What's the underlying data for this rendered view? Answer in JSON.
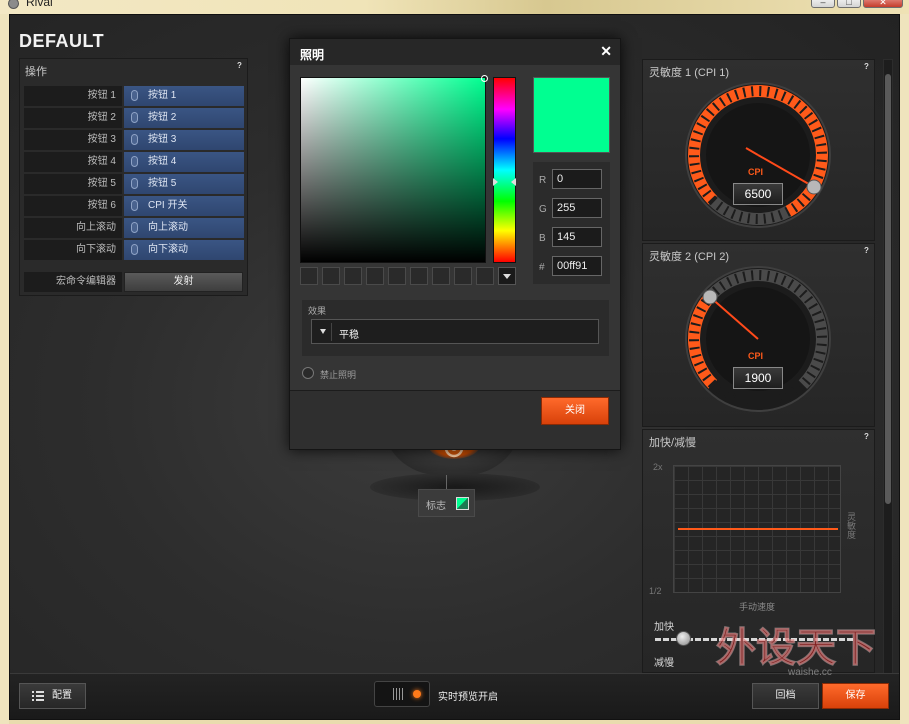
{
  "window": {
    "title": "Rival",
    "controls": [
      "–",
      "□",
      "✕"
    ]
  },
  "profile": {
    "title": "DEFAULT"
  },
  "operations": {
    "label": "操作",
    "help": "?",
    "rows": [
      {
        "name": "按钮 1",
        "action": "按钮 1"
      },
      {
        "name": "按钮 2",
        "action": "按钮 2"
      },
      {
        "name": "按钮 3",
        "action": "按钮 3"
      },
      {
        "name": "按钮 4",
        "action": "按钮 4"
      },
      {
        "name": "按钮 5",
        "action": "按钮 5"
      },
      {
        "name": "按钮 6",
        "action": "CPI 开关"
      },
      {
        "name": "向上滚动",
        "action": "向上滚动"
      },
      {
        "name": "向下滚动",
        "action": "向下滚动"
      }
    ],
    "macro_label": "宏命令编辑器",
    "fire_label": "发射"
  },
  "lighting_dialog": {
    "title": "照明",
    "close_glyph": "✕",
    "color_hex": "#00ff91",
    "rgb": {
      "r_label": "R",
      "r": "0",
      "g_label": "G",
      "g": "255",
      "b_label": "B",
      "b": "145",
      "hex_label": "#",
      "hex": "00ff91"
    },
    "effect_label": "效果",
    "effect_value": "平稳",
    "disable_label": "禁止照明",
    "close_button": "关闭"
  },
  "logo_tag": {
    "label": "标志",
    "color_hex": "#00ff91"
  },
  "sensitivity1": {
    "label": "灵敏度 1 (CPI 1)",
    "help": "?",
    "gauge_label": "CPI",
    "value": "6500"
  },
  "sensitivity2": {
    "label": "灵敏度 2 (CPI 2)",
    "help": "?",
    "gauge_label": "CPI",
    "value": "1900"
  },
  "acceleration": {
    "label": "加快/减慢",
    "help": "?",
    "y_top": "2x",
    "y_bottom": "1/2",
    "x_label": "手动速度",
    "y_label": "灵敏度",
    "accel_label": "加快",
    "decel_label": "减慢"
  },
  "bottom_bar": {
    "config_label": "配置",
    "preview_label": "实时预览开启",
    "revert_label": "回档",
    "save_label": "保存"
  },
  "watermark": {
    "text": "外设天下",
    "url": "waishe.cc"
  },
  "colors": {
    "accent": "#ff5a1a",
    "button_blue": "#34507e",
    "dialog_bg": "#353535",
    "brand_orange": "#ff7a1a"
  }
}
